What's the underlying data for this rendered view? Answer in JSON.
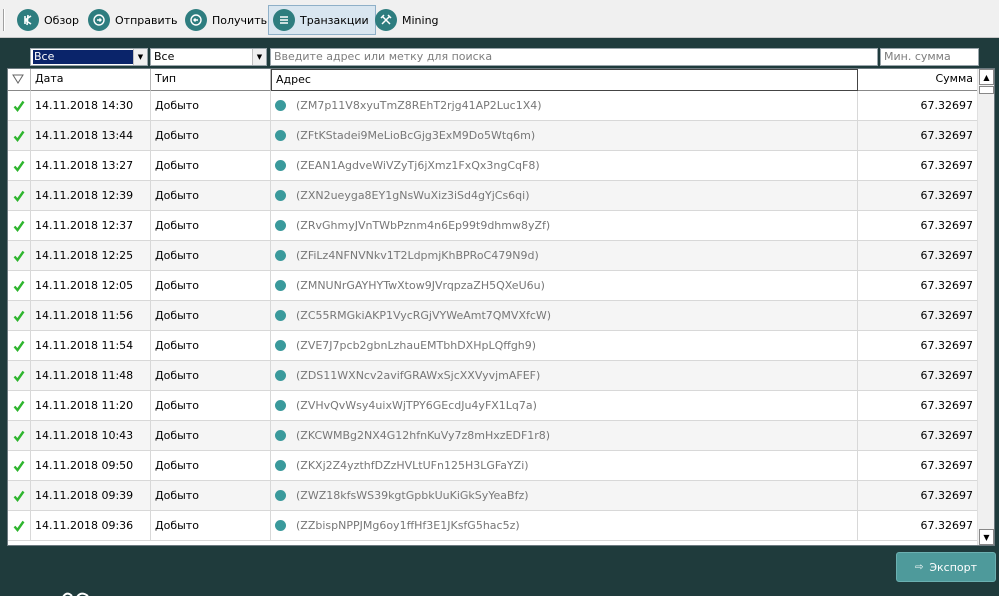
{
  "toolbar": {
    "items": [
      {
        "label": "Обзор",
        "icon": "overview-icon"
      },
      {
        "label": "Отправить",
        "icon": "send-icon"
      },
      {
        "label": "Получить",
        "icon": "receive-icon"
      },
      {
        "label": "Транзакции",
        "icon": "transactions-icon",
        "active": true
      },
      {
        "label": "Mining",
        "icon": "mining-icon"
      }
    ]
  },
  "filters": {
    "date_value": "Все",
    "type_value": "Все",
    "search_placeholder": "Введите адрес или метку для поиска",
    "min_amount_placeholder": "Мин. сумма"
  },
  "table": {
    "columns": {
      "status": "",
      "date": "Дата",
      "type": "Тип",
      "address": "Адрес",
      "amount": "Сумма"
    },
    "rows": [
      {
        "date": "14.11.2018 14:30",
        "type": "Добыто",
        "address": "(ZM7p11V8xyuTmZ8REhT2rjg41AP2Luc1X4)",
        "amount": "67.32697"
      },
      {
        "date": "14.11.2018 13:44",
        "type": "Добыто",
        "address": "(ZFtKStadei9MeLioBcGjg3ExM9Do5Wtq6m)",
        "amount": "67.32697"
      },
      {
        "date": "14.11.2018 13:27",
        "type": "Добыто",
        "address": "(ZEAN1AgdveWiVZyTj6jXmz1FxQx3ngCqF8)",
        "amount": "67.32697"
      },
      {
        "date": "14.11.2018 12:39",
        "type": "Добыто",
        "address": "(ZXN2ueyga8EY1gNsWuXiz3iSd4gYjCs6qi)",
        "amount": "67.32697"
      },
      {
        "date": "14.11.2018 12:37",
        "type": "Добыто",
        "address": "(ZRvGhmyJVnTWbPznm4n6Ep99t9dhmw8yZf)",
        "amount": "67.32697"
      },
      {
        "date": "14.11.2018 12:25",
        "type": "Добыто",
        "address": "(ZFiLz4NFNVNkv1T2LdpmjKhBPRoC479N9d)",
        "amount": "67.32697"
      },
      {
        "date": "14.11.2018 12:05",
        "type": "Добыто",
        "address": "(ZMNUNrGAYHYTwXtow9JVrqpzaZH5QXeU6u)",
        "amount": "67.32697"
      },
      {
        "date": "14.11.2018 11:56",
        "type": "Добыто",
        "address": "(ZC55RMGkiAKP1VycRGjVYWeAmt7QMVXfcW)",
        "amount": "67.32697"
      },
      {
        "date": "14.11.2018 11:54",
        "type": "Добыто",
        "address": "(ZVE7J7pcb2gbnLzhauEMTbhDXHpLQffgh9)",
        "amount": "67.32697"
      },
      {
        "date": "14.11.2018 11:48",
        "type": "Добыто",
        "address": "(ZDS11WXNcv2avifGRAWxSjcXXVyvjmAFEF)",
        "amount": "67.32697"
      },
      {
        "date": "14.11.2018 11:20",
        "type": "Добыто",
        "address": "(ZVHvQvWsy4uixWjTPY6GEcdJu4yFX1Lq7a)",
        "amount": "67.32697"
      },
      {
        "date": "14.11.2018 10:43",
        "type": "Добыто",
        "address": "(ZKCWMBg2NX4G12hfnKuVy7z8mHxzEDF1r8)",
        "amount": "67.32697"
      },
      {
        "date": "14.11.2018 09:50",
        "type": "Добыто",
        "address": "(ZKXj2Z4yzthfDZzHVLtUFn125H3LGFaYZi)",
        "amount": "67.32697"
      },
      {
        "date": "14.11.2018 09:39",
        "type": "Добыто",
        "address": "(ZWZ18kfsWS39kgtGpbkUuKiGkSyYeaBfz)",
        "amount": "67.32697"
      },
      {
        "date": "14.11.2018 09:36",
        "type": "Добыто",
        "address": "(ZZbispNPPJMg6oy1ffHf3E1JKsfG5hac5z)",
        "amount": "67.32697"
      }
    ]
  },
  "export_label": "Экспорт",
  "colors": {
    "accent": "#2e7d7f",
    "background": "#1f3b3c",
    "check": "#2fb52f",
    "button": "#4e9a9b"
  }
}
